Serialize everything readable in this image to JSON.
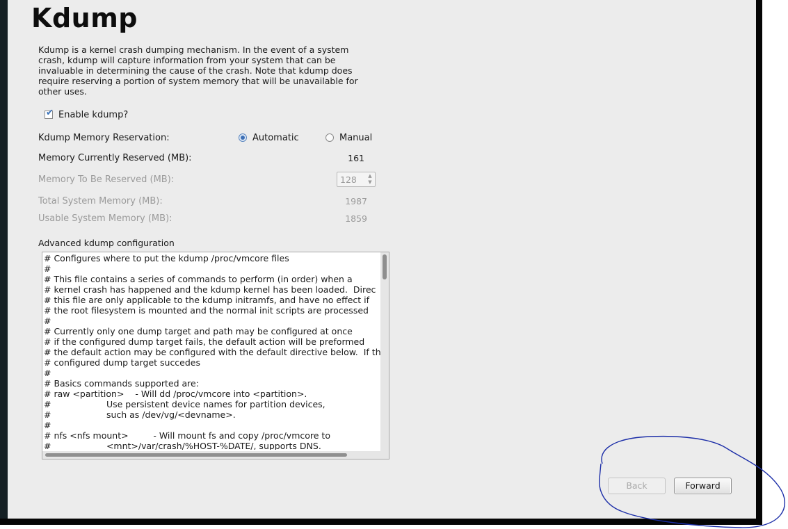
{
  "page": {
    "title": "Kdump",
    "description": "Kdump is a kernel crash dumping mechanism. In the event of a system crash, kdump will capture information from your system that can be invaluable in determining the cause of the crash. Note that kdump does require reserving a portion of system memory that will be unavailable for other uses."
  },
  "enable": {
    "label": "Enable kdump?",
    "checked": true
  },
  "reservation": {
    "label": "Kdump Memory Reservation:",
    "options": [
      {
        "label": "Automatic",
        "selected": true
      },
      {
        "label": "Manual",
        "selected": false
      }
    ]
  },
  "memory": {
    "current_label": "Memory Currently Reserved (MB):",
    "current_value": "161",
    "to_reserve_label": "Memory To Be Reserved (MB):",
    "to_reserve_value": "128",
    "total_label": "Total System Memory (MB):",
    "total_value": "1987",
    "usable_label": "Usable System Memory (MB):",
    "usable_value": "1859"
  },
  "advanced": {
    "label": "Advanced kdump configuration",
    "lines": [
      "# Configures where to put the kdump /proc/vmcore files",
      "#",
      "# This file contains a series of commands to perform (in order) when a",
      "# kernel crash has happened and the kdump kernel has been loaded.  Direc",
      "# this file are only applicable to the kdump initramfs, and have no effect if",
      "# the root filesystem is mounted and the normal init scripts are processed",
      "#",
      "# Currently only one dump target and path may be configured at once",
      "# if the configured dump target fails, the default action will be preformed",
      "# the default action may be configured with the default directive below.  If th",
      "# configured dump target succedes",
      "#",
      "# Basics commands supported are:",
      "# raw <partition>    - Will dd /proc/vmcore into <partition>.",
      "#                    Use persistent device names for partition devices,",
      "#                    such as /dev/vg/<devname>.",
      "#",
      "# nfs <nfs mount>         - Will mount fs and copy /proc/vmcore to",
      "#                    <mnt>/var/crash/%HOST-%DATE/, supports DNS."
    ]
  },
  "buttons": {
    "back": "Back",
    "forward": "Forward"
  },
  "colors": {
    "annotation": "#1c2ea8",
    "accent": "#3d6fb5"
  }
}
